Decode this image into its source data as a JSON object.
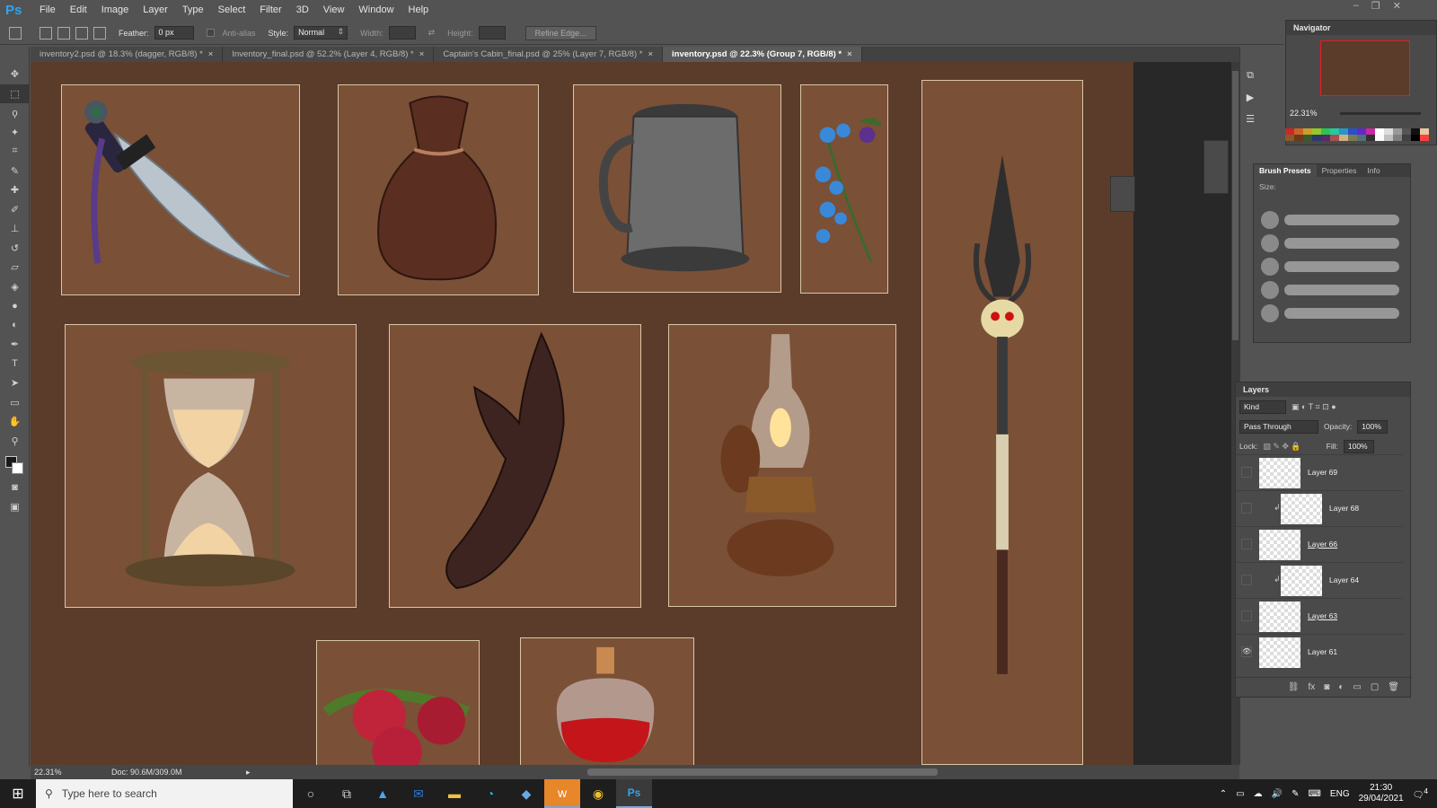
{
  "app": {
    "logo": "Ps"
  },
  "menu": [
    "File",
    "Edit",
    "Image",
    "Layer",
    "Type",
    "Select",
    "Filter",
    "3D",
    "View",
    "Window",
    "Help"
  ],
  "options_bar": {
    "feather_label": "Feather:",
    "feather_value": "0 px",
    "antialias_label": "Anti-alias",
    "style_label": "Style:",
    "style_value": "Normal",
    "width_label": "Width:",
    "height_label": "Height:",
    "refine_edge_label": "Refine Edge..."
  },
  "tabs": [
    {
      "label": "inventory2.psd @ 18.3% (dagger, RGB/8) *",
      "active": false
    },
    {
      "label": "Inventory_final.psd @ 52.2% (Layer 4, RGB/8) *",
      "active": false
    },
    {
      "label": "Captain's Cabin_final.psd @ 25% (Layer 7, RGB/8) *",
      "active": false
    },
    {
      "label": "inventory.psd @ 22.3% (Group 7, RGB/8) *",
      "active": true
    }
  ],
  "status": {
    "zoom": "22.31%",
    "doc": "Doc: 90.6M/309.0M"
  },
  "navigator": {
    "title": "Navigator",
    "zoom": "22.31%"
  },
  "brush_panel": {
    "tabs": [
      "Brush Presets",
      "Properties",
      "Info"
    ],
    "size_label": "Size:"
  },
  "layers_panel": {
    "title": "Layers",
    "kind_label": "Kind",
    "blend_mode": "Pass Through",
    "opacity_label": "Opacity:",
    "opacity_value": "100%",
    "lock_label": "Lock:",
    "fill_label": "Fill:",
    "fill_value": "100%",
    "layers": [
      {
        "name": "Layer 69",
        "visible": false,
        "clipped": false,
        "underlined": false
      },
      {
        "name": "Layer 68",
        "visible": false,
        "clipped": true,
        "underlined": false
      },
      {
        "name": "Layer 66",
        "visible": false,
        "clipped": false,
        "underlined": true
      },
      {
        "name": "Layer 64",
        "visible": false,
        "clipped": true,
        "underlined": false
      },
      {
        "name": "Layer 63",
        "visible": false,
        "clipped": false,
        "underlined": true
      },
      {
        "name": "Layer 61",
        "visible": true,
        "clipped": false,
        "underlined": false
      }
    ]
  },
  "canvas_items": [
    "dagger",
    "pouch",
    "tankard",
    "flowers",
    "spear",
    "hourglass",
    "glove",
    "lamp",
    "raspberries",
    "potion"
  ],
  "taskbar": {
    "search_placeholder": "Type here to search",
    "lang": "ENG",
    "time": "21:30",
    "date": "29/04/2021",
    "notifications": "4"
  },
  "colors": {
    "canvas_bg": "#5b3c2b",
    "card_bg": "#7a5037",
    "card_border": "#d9c7a5",
    "ps_blue": "#2fa3f5"
  }
}
